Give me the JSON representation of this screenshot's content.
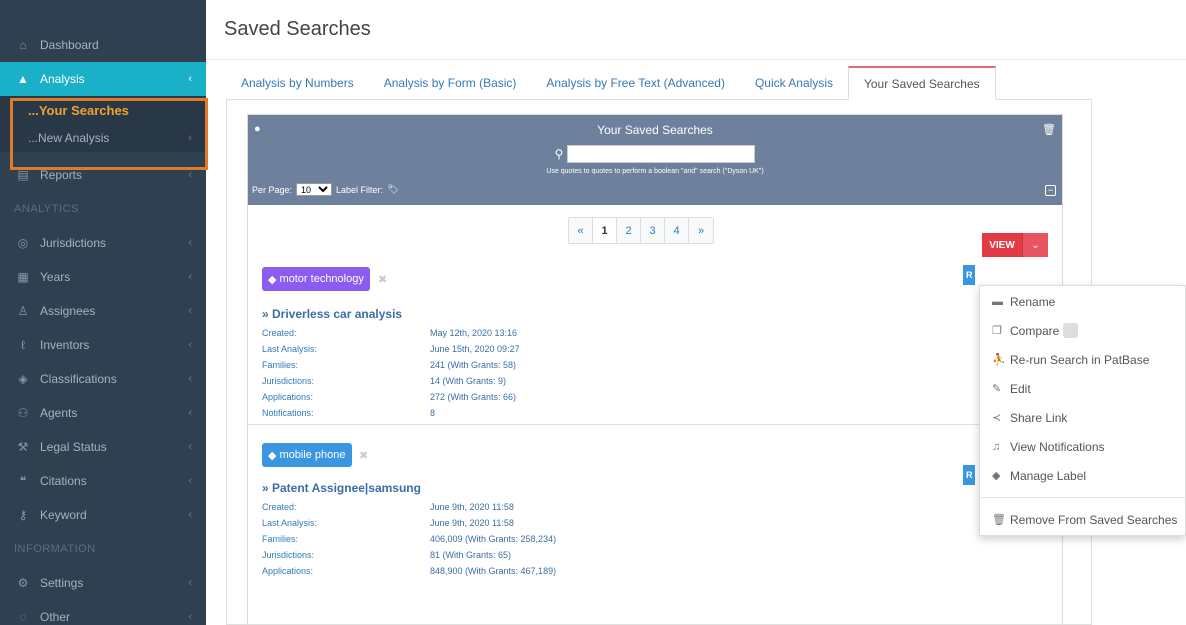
{
  "sidebar": {
    "items": [
      {
        "label": "Dashboard",
        "icon": "home-icon"
      },
      {
        "label": "Analysis",
        "icon": "area-chart-icon"
      },
      {
        "label": "...Your Searches"
      },
      {
        "label": "...New Analysis"
      },
      {
        "label": "Reports",
        "icon": "file-icon"
      },
      {
        "label": "ANALYTICS"
      },
      {
        "label": "Jurisdictions",
        "icon": "globe-icon"
      },
      {
        "label": "Years",
        "icon": "calendar-icon"
      },
      {
        "label": "Assignees",
        "icon": "user-icon"
      },
      {
        "label": "Inventors",
        "icon": "lightbulb-icon"
      },
      {
        "label": "Classifications",
        "icon": "layers-icon"
      },
      {
        "label": "Agents",
        "icon": "users-icon"
      },
      {
        "label": "Legal Status",
        "icon": "gavel-icon"
      },
      {
        "label": "Citations",
        "icon": "quote-icon"
      },
      {
        "label": "Keyword",
        "icon": "key-icon"
      },
      {
        "label": "INFORMATION"
      },
      {
        "label": "Settings",
        "icon": "gear-icon"
      },
      {
        "label": "Other",
        "icon": "circle-icon"
      }
    ],
    "accent_color": "#1ab0c8",
    "highlight_color": "#e07b2a"
  },
  "header": {
    "title": "Saved Searches"
  },
  "tabs": [
    {
      "label": "Analysis by Numbers"
    },
    {
      "label": "Analysis by Form (Basic)"
    },
    {
      "label": "Analysis by Free Text (Advanced)"
    },
    {
      "label": "Quick Analysis"
    },
    {
      "label": "Your Saved Searches"
    }
  ],
  "panel": {
    "title": "Your Saved Searches",
    "search_value": "",
    "hint": "Use quotes to quotes to perform a boolean \"and\" search (\"Dyson UK\")",
    "per_page_label": "Per Page:",
    "per_page_value": "10",
    "label_filter": "Label Filter:"
  },
  "pagination": [
    "«",
    "1",
    "2",
    "3",
    "4",
    "»"
  ],
  "results": [
    {
      "tag": "motor technology",
      "title": "» Driverless car analysis",
      "fields": [
        {
          "k": "Created:",
          "v": "May 12th, 2020 13:16"
        },
        {
          "k": "Last Analysis:",
          "v": "June 15th, 2020 09:27"
        },
        {
          "k": "Families:",
          "v": "241 (With Grants: 58)"
        },
        {
          "k": "Jurisdictions:",
          "v": "14 (With Grants: 9)"
        },
        {
          "k": "Applications:",
          "v": "272 (With Grants: 66)"
        },
        {
          "k": "Notifications:",
          "v": "8"
        }
      ]
    },
    {
      "tag": "mobile phone",
      "title": "» Patent Assignee|samsung",
      "fields": [
        {
          "k": "Created:",
          "v": "June 9th, 2020 11:58"
        },
        {
          "k": "Last Analysis:",
          "v": "June 9th, 2020 11:58"
        },
        {
          "k": "Families:",
          "v": "406,009 (With Grants: 258,234)"
        },
        {
          "k": "Jurisdictions:",
          "v": "81 (With Grants: 65)"
        },
        {
          "k": "Applications:",
          "v": "848,900 (With Grants: 467,189)"
        }
      ]
    }
  ],
  "view_button": {
    "label": "VIEW"
  },
  "side_button_label": "R",
  "dropdown": {
    "items": [
      {
        "label": "Rename",
        "icon": "tag-edit-icon"
      },
      {
        "label": "Compare",
        "icon": "copy-icon"
      },
      {
        "label": "Re-run Search in PatBase",
        "icon": "running-icon"
      },
      {
        "label": "Edit",
        "icon": "edit-icon"
      },
      {
        "label": "Share Link",
        "icon": "share-icon"
      },
      {
        "label": "View Notifications",
        "icon": "bell-icon"
      },
      {
        "label": "Manage Label",
        "icon": "tags-icon"
      },
      {
        "label": "Remove From Saved Searches",
        "icon": "trash-icon"
      }
    ]
  }
}
